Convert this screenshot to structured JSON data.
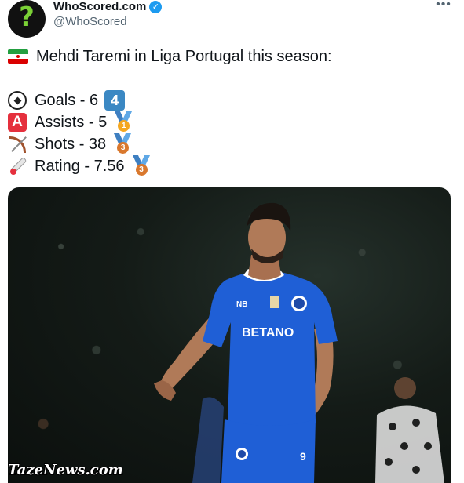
{
  "tweet": {
    "display_name": "WhoScored.com",
    "handle": "@WhoScored",
    "title_line": "Mehdi Taremi in Liga Portugal this season:",
    "stats": [
      {
        "label": "Goals - 6",
        "badge": "4",
        "badge_type": "keycap"
      },
      {
        "label": "Assists - 5",
        "badge": "1",
        "badge_type": "medal"
      },
      {
        "label": "Shots - 38",
        "badge": "3",
        "badge_type": "medal"
      },
      {
        "label": "Rating - 7.56",
        "badge": "3",
        "badge_type": "medal"
      }
    ]
  },
  "image": {
    "jersey_sponsor": "BETANO",
    "watermark": "TazeNews.com"
  },
  "icons": {
    "avatar": "question-mark-logo",
    "verified": "verified-badge-icon",
    "more": "more-options-icon",
    "flag": "iran-flag-icon",
    "goals": "soccer-ball-icon",
    "assists": "letter-a-icon",
    "shots": "bow-arrow-icon",
    "rating": "thermometer-icon"
  },
  "colors": {
    "verified": "#1d9bf0",
    "keycap": "#3b88c3",
    "medal_gold": "#f4a720",
    "medal_bronze": "#d9782d",
    "jersey": "#1f5fd6"
  }
}
